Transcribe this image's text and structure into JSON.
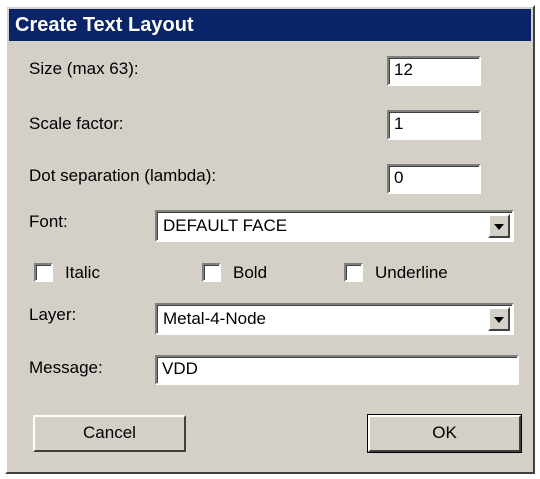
{
  "window": {
    "title": "Create Text Layout"
  },
  "fields": {
    "size": {
      "label": "Size (max 63):",
      "value": "12"
    },
    "scale": {
      "label": "Scale factor:",
      "value": "1"
    },
    "dot_separation": {
      "label": "Dot separation (lambda):",
      "value": "0"
    },
    "font": {
      "label": "Font:",
      "value": "DEFAULT FACE"
    },
    "layer": {
      "label": "Layer:",
      "value": "Metal-4-Node"
    },
    "message": {
      "label": "Message:",
      "value": "VDD"
    }
  },
  "checkboxes": {
    "italic": {
      "label": "Italic",
      "checked": false
    },
    "bold": {
      "label": "Bold",
      "checked": false
    },
    "underline": {
      "label": "Underline",
      "checked": false
    }
  },
  "buttons": {
    "cancel": "Cancel",
    "ok": "OK"
  },
  "icons": {
    "dropdown": "chevron-down-icon"
  },
  "colors": {
    "title_bar": "#0a246a",
    "dialog_face": "#d4d0c8"
  }
}
